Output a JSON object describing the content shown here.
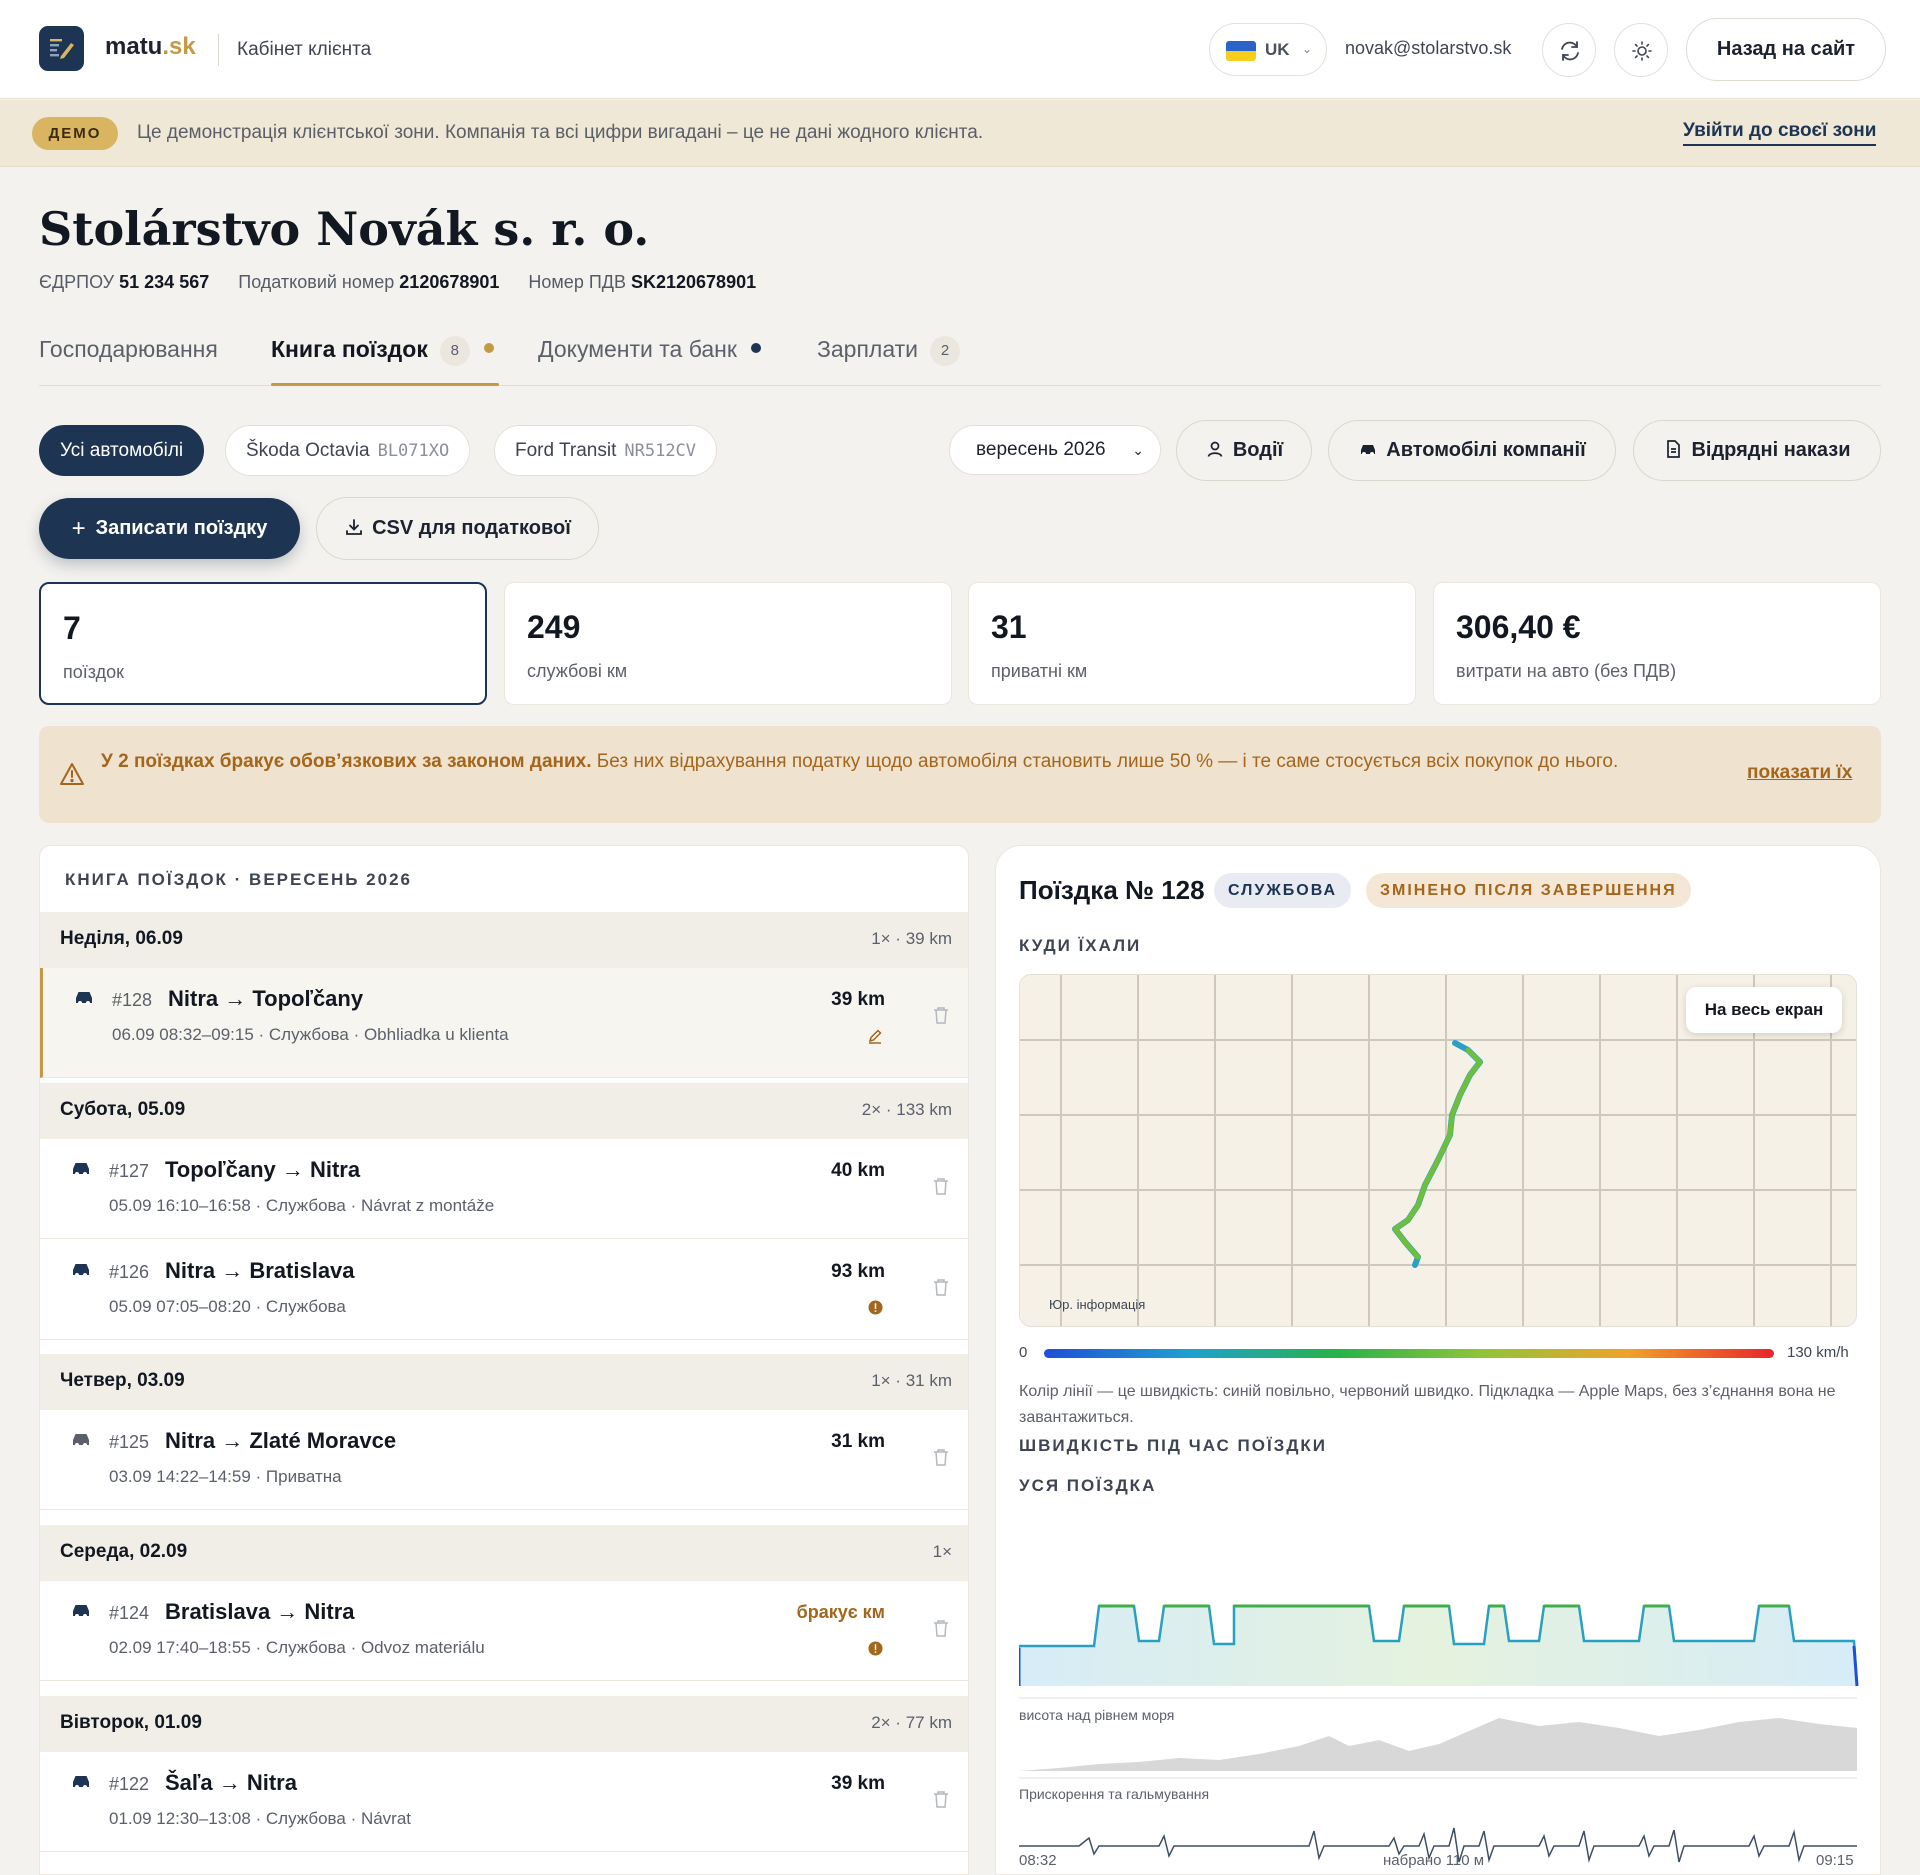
{
  "header": {
    "brand_main": "matu",
    "brand_dot": ".sk",
    "subtitle": "Кабінет клієнта",
    "lang_code": "UK",
    "email": "novak@stolarstvo.sk",
    "back_label": "Назад на сайт"
  },
  "demo": {
    "badge": "ДЕМО",
    "text": "Це демонстрація клієнтської зони. Компанія та всі цифри вигадані – це не дані жодного клієнта.",
    "link": "Увійти до своєї зони"
  },
  "company": {
    "name": "Stolárstvo Novák s. r. o.",
    "ids": [
      {
        "label": "ЄДРПОУ",
        "value": "51 234 567"
      },
      {
        "label": "Податковий номер",
        "value": "2120678901"
      },
      {
        "label": "Номер ПДВ",
        "value": "SK2120678901"
      }
    ]
  },
  "tabs": [
    {
      "label": "Господарювання"
    },
    {
      "label": "Книга поїздок",
      "count": "8"
    },
    {
      "label": "Документи та банк"
    },
    {
      "label": "Зарплати",
      "count": "2"
    }
  ],
  "filters": {
    "all_cars": "Усі автомобілі",
    "cars": [
      {
        "name": "Škoda Octavia",
        "plate": "BL071XO"
      },
      {
        "name": "Ford Transit",
        "plate": "NR512CV"
      }
    ],
    "month": "вересень 2026",
    "drivers": "Водії",
    "company_cars": "Автомобілі компанії",
    "travel_orders": "Відрядні накази",
    "add_trip": "Записати поїздку",
    "csv": "CSV для податкової"
  },
  "stats": [
    {
      "value": "7",
      "label": "поїздок"
    },
    {
      "value": "249",
      "label": "службові км"
    },
    {
      "value": "31",
      "label": "приватні км"
    },
    {
      "value": "306,40 €",
      "label": "витрати на авто (без ПДВ)"
    }
  ],
  "warning": {
    "bold": "У 2 поїздках бракує обов’язкових за законом даних.",
    "text": " Без них відрахування податку щодо автомобіля становить лише 50 % — і те саме стосується всіх покупок до нього.",
    "link": "показати їх"
  },
  "log": {
    "title": "КНИГА ПОЇЗДОК · ВЕРЕСЕНЬ 2026",
    "days": [
      {
        "day": "Неділя, 06.09",
        "summary": "1× · 39 km"
      },
      {
        "day": "Субота, 05.09",
        "summary": "2× · 133 km"
      },
      {
        "day": "Четвер, 03.09",
        "summary": "1× · 31 km"
      },
      {
        "day": "Середа, 02.09",
        "summary": "1×"
      },
      {
        "day": "Вівторок, 01.09",
        "summary": "2× · 77 km"
      }
    ],
    "trips": [
      {
        "num": "#128",
        "route": "Nitra → Topoľčany",
        "meta": "06.09 08:32–09:15 · Службова · Obhliadka u klienta",
        "km": "39 km"
      },
      {
        "num": "#127",
        "route": "Topoľčany → Nitra",
        "meta": "05.09 16:10–16:58 · Службова · Návrat z montáže",
        "km": "40 km"
      },
      {
        "num": "#126",
        "route": "Nitra → Bratislava",
        "meta": "05.09 07:05–08:20 · Службова",
        "km": "93 km"
      },
      {
        "num": "#125",
        "route": "Nitra → Zlaté Moravce",
        "meta": "03.09 14:22–14:59 · Приватна",
        "km": "31 km"
      },
      {
        "num": "#124",
        "route": "Bratislava → Nitra",
        "meta": "02.09 17:40–18:55 · Службова · Odvoz materiálu",
        "km": "бракує км"
      },
      {
        "num": "#122",
        "route": "Šaľa → Nitra",
        "meta": "01.09 12:30–13:08 · Службова · Návrat",
        "km": "39 km"
      }
    ]
  },
  "detail": {
    "title": "Поїздка № 128",
    "badge_type": "СЛУЖБОВА",
    "badge_edit": "ЗМІНЕНО ПІСЛЯ ЗАВЕРШЕННЯ",
    "where": "КУДИ ЇХАЛИ",
    "fullscreen": "На весь екран",
    "map_legal": "Юр. інформація",
    "speed_min": "0",
    "speed_max": "130 km/h",
    "legend_note": "Колір лінії — це швидкість: синій повільно, червоний швидко. Підкладка — Apple Maps, без з’єднання вона не завантажиться.",
    "speed_title": "ШВИДКІСТЬ ПІД ЧАС ПОЇЗДКИ",
    "whole_trip": "УСЯ ПОЇЗДКА",
    "altitude_label": "висота над рівнем моря",
    "accel_label": "Прискорення та гальмування",
    "time_start": "08:32",
    "elevation_gain": "набрано 110 м",
    "time_end": "09:15"
  },
  "colors": {
    "navy": "#1d3453",
    "gold": "#c19a43",
    "warn": "#a3661c"
  }
}
